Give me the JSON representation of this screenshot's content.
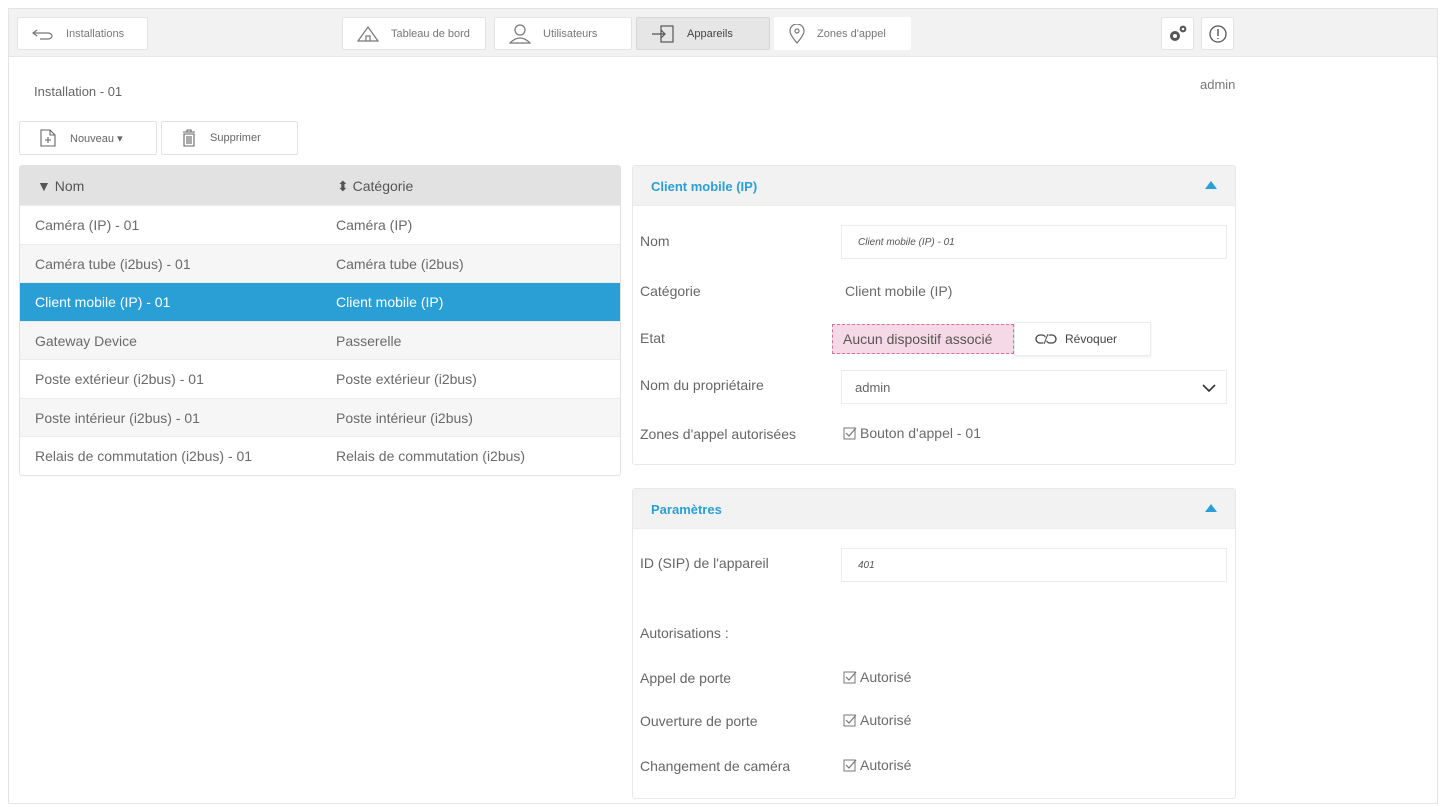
{
  "topbar": {
    "back_label": "Installations",
    "tabs": [
      {
        "label": "Tableau de bord",
        "icon": "home-icon"
      },
      {
        "label": "Utilisateurs",
        "icon": "user-icon"
      },
      {
        "label": "Appareils",
        "icon": "devices-icon"
      },
      {
        "label": "Zones d'appel",
        "icon": "location-pin-icon"
      }
    ],
    "active_tab": "Appareils",
    "settings_icon": "gears-icon",
    "info_icon": "info-icon"
  },
  "breadcrumb": "Installation - 01",
  "user": "admin",
  "actions": {
    "new_label": "Nouveau ▾",
    "delete_label": "Supprimer"
  },
  "table": {
    "headers": [
      "▼ Nom",
      "⬍ Catégorie"
    ],
    "rows": [
      {
        "name": "Caméra (IP) - 01",
        "category": "Caméra (IP)"
      },
      {
        "name": "Caméra tube (i2bus) - 01",
        "category": "Caméra tube (i2bus)"
      },
      {
        "name": "Client mobile (IP) - 01",
        "category": "Client mobile (IP)"
      },
      {
        "name": "Gateway Device",
        "category": "Passerelle"
      },
      {
        "name": "Poste extérieur (i2bus) - 01",
        "category": "Poste extérieur (i2bus)"
      },
      {
        "name": "Poste intérieur (i2bus) - 01",
        "category": "Poste intérieur (i2bus)"
      },
      {
        "name": "Relais de commutation (i2bus) - 01",
        "category": "Relais de commutation (i2bus)"
      }
    ],
    "selected_index": 2
  },
  "device_panel": {
    "title": "Client mobile (IP)",
    "name_label": "Nom",
    "name_value": "Client mobile (IP) - 01",
    "category_label": "Catégorie",
    "category_value": "Client mobile (IP)",
    "state_label": "Etat",
    "state_value": "Aucun dispositif associé",
    "revoke_label": "Révoquer",
    "owner_label": "Nom du propriétaire",
    "owner_value": "admin",
    "zones_label": "Zones d'appel autorisées",
    "zones_value": "Bouton d'appel - 01"
  },
  "params_panel": {
    "title": "Paramètres",
    "sip_label": "ID (SIP) de l'appareil",
    "sip_value": "401",
    "auth_label": "Autorisations :",
    "permissions": [
      {
        "label": "Appel de porte",
        "value": "Autorisé"
      },
      {
        "label": "Ouverture de porte",
        "value": "Autorisé"
      },
      {
        "label": "Changement de caméra",
        "value": "Autorisé"
      }
    ]
  },
  "colors": {
    "accent": "#2a9fd6",
    "state_bg": "#f6d9e6",
    "state_border": "#d2709e"
  }
}
